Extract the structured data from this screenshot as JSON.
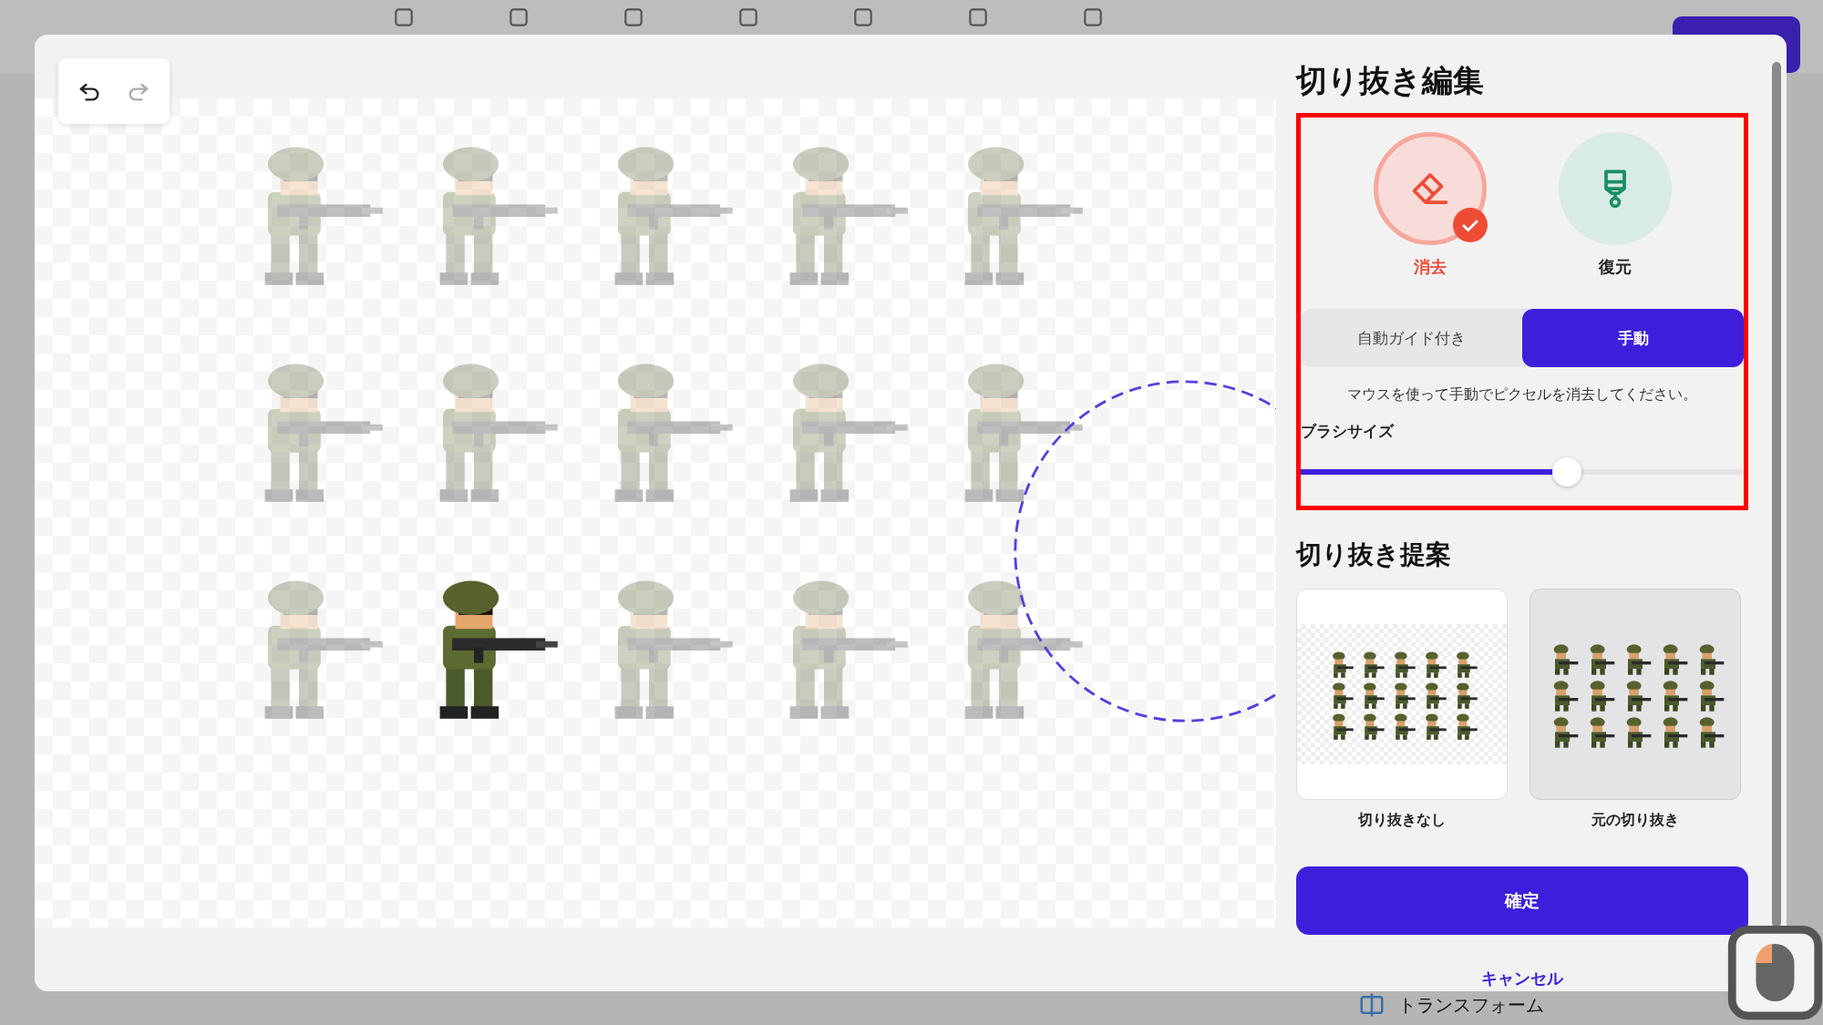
{
  "background_app": {
    "bottom_item": {
      "label": "トランスフォーム"
    }
  },
  "canvas": {
    "sprites": [
      {
        "selected": false
      },
      {
        "selected": false
      },
      {
        "selected": false
      },
      {
        "selected": false
      },
      {
        "selected": false
      },
      {
        "selected": false
      },
      {
        "selected": false
      },
      {
        "selected": false
      },
      {
        "selected": false
      },
      {
        "selected": false
      },
      {
        "selected": false
      },
      {
        "selected": true
      },
      {
        "selected": false
      },
      {
        "selected": false
      },
      {
        "selected": false
      }
    ]
  },
  "edit_panel": {
    "title": "切り抜き編集",
    "tools": [
      {
        "label": "消去",
        "kind": "erase",
        "selected": true
      },
      {
        "label": "復元",
        "kind": "restore",
        "selected": false
      }
    ],
    "modes": [
      {
        "label": "自動ガイド付き",
        "selected": false
      },
      {
        "label": "手動",
        "selected": true
      }
    ],
    "hint": "マウスを使って手動でピクセルを消去してください。",
    "brush_size": {
      "label": "ブラシサイズ",
      "level": 0.6
    }
  },
  "suggestions": {
    "title": "切り抜き提案",
    "items": [
      {
        "label": "切り抜きなし",
        "kind": "transparent",
        "selected": false
      },
      {
        "label": "元の切り抜き",
        "kind": "original",
        "selected": true
      }
    ]
  },
  "confirm_button": "確定",
  "cancel_link": "キャンセル"
}
